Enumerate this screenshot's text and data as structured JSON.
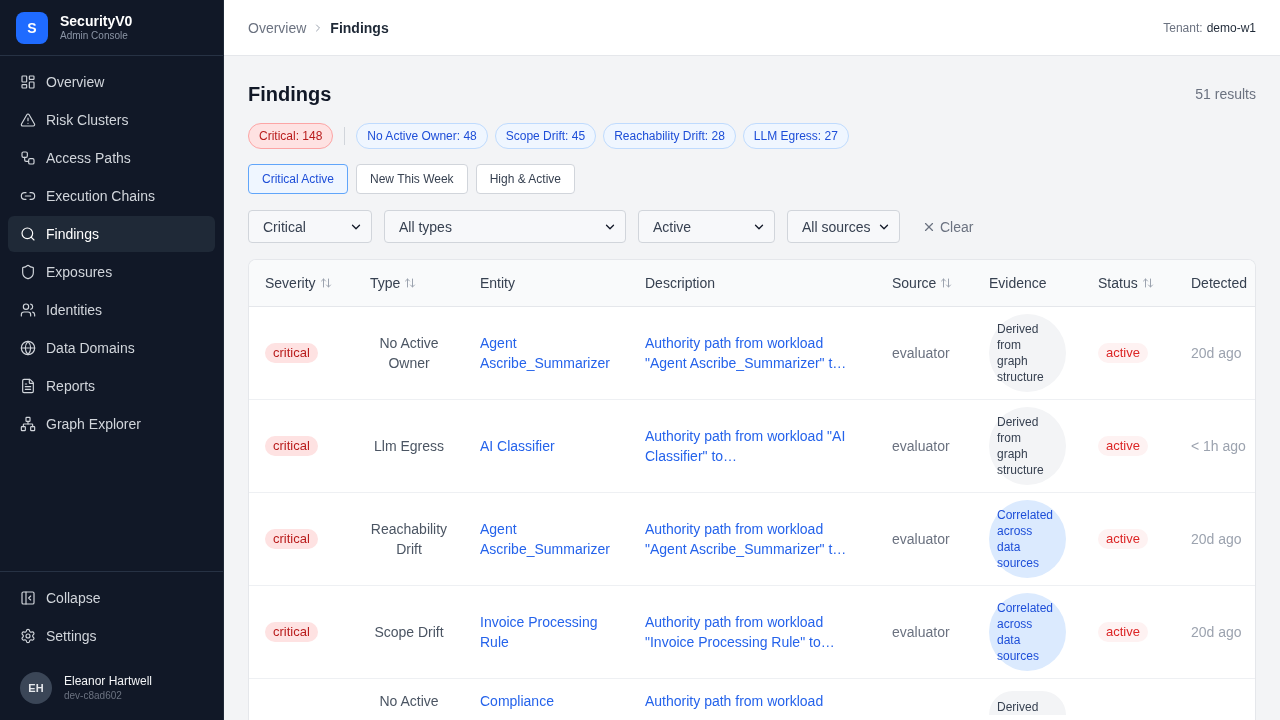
{
  "brand": {
    "logo_letter": "S",
    "name": "SecurityV0",
    "subtitle": "Admin Console"
  },
  "sidebar": {
    "items": [
      {
        "label": "Overview",
        "selected": false
      },
      {
        "label": "Risk Clusters",
        "selected": false
      },
      {
        "label": "Access Paths",
        "selected": false
      },
      {
        "label": "Execution Chains",
        "selected": false
      },
      {
        "label": "Findings",
        "selected": true
      },
      {
        "label": "Exposures",
        "selected": false
      },
      {
        "label": "Identities",
        "selected": false
      },
      {
        "label": "Data Domains",
        "selected": false
      },
      {
        "label": "Reports",
        "selected": false
      },
      {
        "label": "Graph Explorer",
        "selected": false
      }
    ],
    "footer_items": [
      {
        "label": "Collapse"
      },
      {
        "label": "Settings"
      }
    ],
    "user": {
      "initials": "EH",
      "name": "Eleanor Hartwell",
      "id": "dev-c8ad602"
    }
  },
  "top_bar": {
    "breadcrumb": [
      {
        "label": "Overview",
        "current": false
      },
      {
        "label": "Findings",
        "current": true
      }
    ],
    "tenant_label": "Tenant:",
    "tenant": "demo-w1"
  },
  "page": {
    "title": "Findings",
    "result_count": "51 results"
  },
  "summary_chips": [
    {
      "label": "Critical: 148",
      "kind": "severity"
    },
    {
      "label": "No Active Owner: 48",
      "kind": "type"
    },
    {
      "label": "Scope Drift: 45",
      "kind": "type"
    },
    {
      "label": "Reachability Drift: 28",
      "kind": "type"
    },
    {
      "label": "LLM Egress: 27",
      "kind": "type"
    }
  ],
  "presets": [
    {
      "label": "Critical Active",
      "selected": true
    },
    {
      "label": "New This Week",
      "selected": false
    },
    {
      "label": "High & Active",
      "selected": false
    }
  ],
  "filters": [
    {
      "value": "Critical"
    },
    {
      "value": "All types"
    },
    {
      "value": "Active"
    },
    {
      "value": "All sources"
    }
  ],
  "clear_button": {
    "label": "Clear"
  },
  "table": {
    "columns": [
      {
        "label": "Severity",
        "sortable": true
      },
      {
        "label": "Type",
        "sortable": true
      },
      {
        "label": "Entity",
        "sortable": false
      },
      {
        "label": "Description",
        "sortable": false
      },
      {
        "label": "Source",
        "sortable": true
      },
      {
        "label": "Evidence",
        "sortable": false
      },
      {
        "label": "Status",
        "sortable": true
      },
      {
        "label": "Detected",
        "sortable": false
      }
    ],
    "rows": [
      {
        "severity": "critical",
        "type": "No Active Owner",
        "entity": "Agent Ascribe_Summarizer",
        "description": "Authority path from workload \"Agent Ascribe_Summarizer\" t…",
        "source": "evaluator",
        "evidence": {
          "text": "Derived from graph structure",
          "kind": "derived"
        },
        "status": "active",
        "detected": "20d ago"
      },
      {
        "severity": "critical",
        "type": "Llm Egress",
        "entity": "AI Classifier",
        "description": "Authority path from workload \"AI Classifier\" to…",
        "source": "evaluator",
        "evidence": {
          "text": "Derived from graph structure",
          "kind": "derived"
        },
        "status": "active",
        "detected": "< 1h ago"
      },
      {
        "severity": "critical",
        "type": "Reachability Drift",
        "entity": "Agent Ascribe_Summarizer",
        "description": "Authority path from workload \"Agent Ascribe_Summarizer\" t…",
        "source": "evaluator",
        "evidence": {
          "text": "Correlated across data sources",
          "kind": "correlated"
        },
        "status": "active",
        "detected": "20d ago"
      },
      {
        "severity": "critical",
        "type": "Scope Drift",
        "entity": "Invoice Processing Rule",
        "description": "Authority path from workload \"Invoice Processing Rule\" to…",
        "source": "evaluator",
        "evidence": {
          "text": "Correlated across data sources",
          "kind": "correlated"
        },
        "status": "active",
        "detected": "20d ago"
      },
      {
        "type": "No Active",
        "entity": "Compliance",
        "description": "Authority path from workload",
        "evidence": {
          "text": "Derived",
          "kind": "derived"
        }
      }
    ]
  }
}
